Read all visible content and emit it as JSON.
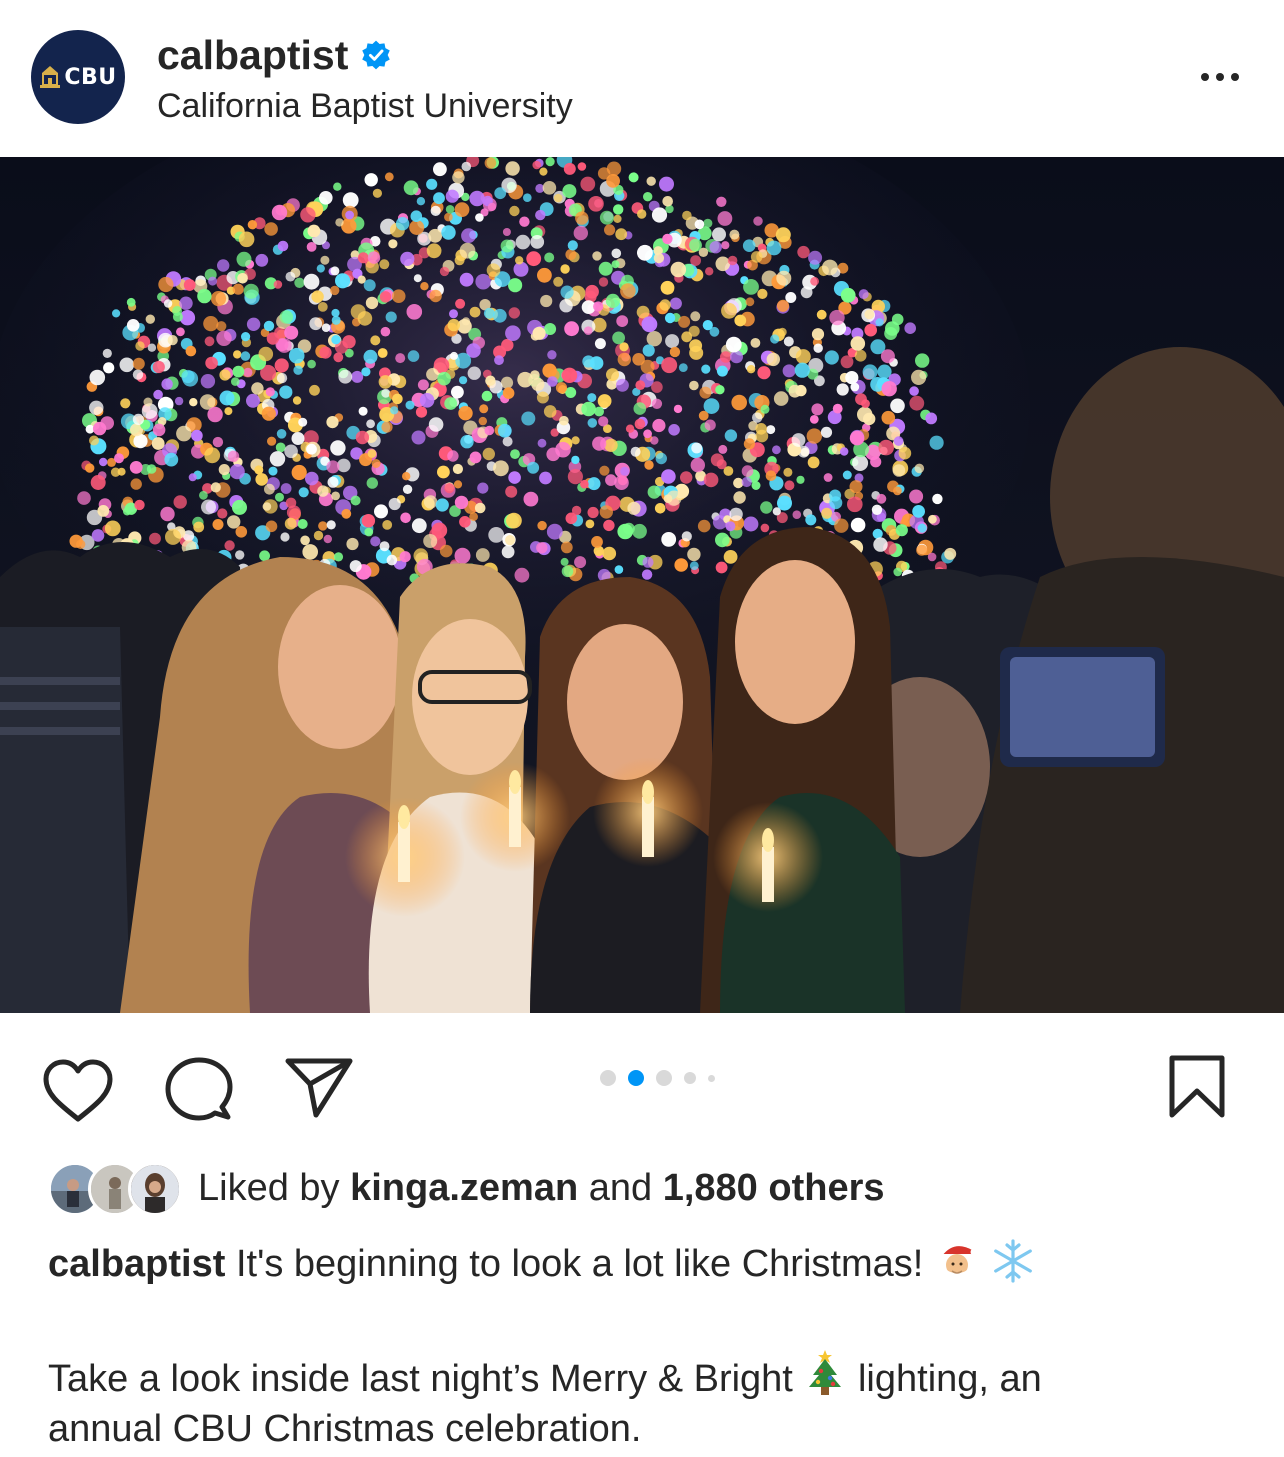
{
  "post": {
    "username": "calbaptist",
    "verified": true,
    "display_name": "California Baptist University",
    "avatar_text": "CBU",
    "avatar_color": "#13244d",
    "more_icon": "more-horizontal-icon",
    "image_alt": "Students holding candles in front of a lit Christmas tree",
    "carousel": {
      "count": 5,
      "active_index": 1,
      "active_color": "#0095f6"
    }
  },
  "actions": {
    "like_icon": "heart-icon",
    "comment_icon": "comment-icon",
    "share_icon": "send-icon",
    "save_icon": "bookmark-icon"
  },
  "likes": {
    "prefix": "Liked by",
    "first_liker": "kinga.zeman",
    "joiner": "and",
    "others": "1,880 others"
  },
  "caption": {
    "username": "calbaptist",
    "line1": "It's beginning to look a lot like Christmas!",
    "line1_emojis": [
      "santa-emoji",
      "snowflake-emoji"
    ],
    "line2_a": "Take a look inside last night’s Merry & Bright",
    "line2_emoji": "christmas-tree-emoji",
    "line2_b": "lighting, an",
    "line3": "annual CBU Christmas celebration."
  },
  "colors": {
    "text": "#262626",
    "verified_blue": "#0095f6",
    "dot_inactive": "#d9d9d9"
  }
}
